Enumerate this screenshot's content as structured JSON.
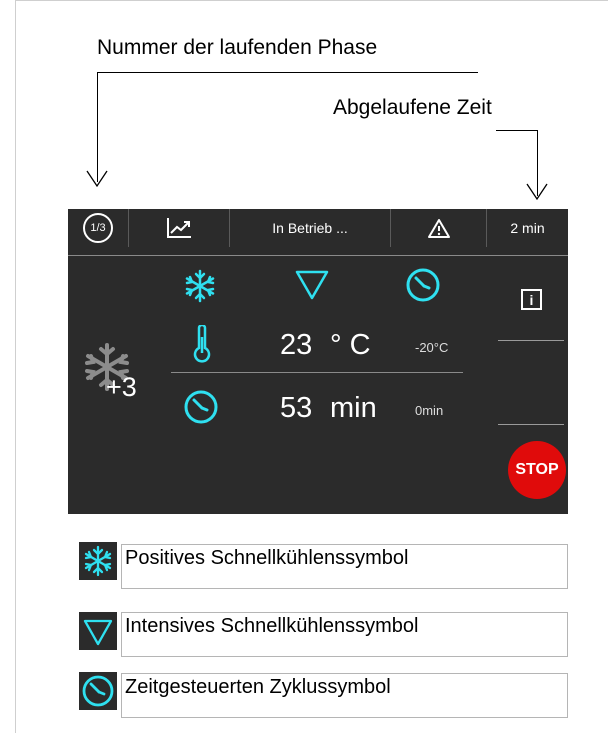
{
  "annotations": {
    "phase_number_label": "Nummer der laufenden Phase",
    "elapsed_time_label": "Abgelaufene Zeit"
  },
  "status_bar": {
    "phase": "1/3",
    "status_text": "In Betrieb ...",
    "elapsed_time": "2 min"
  },
  "main": {
    "counter": "+3",
    "temperature_value": "23",
    "temperature_unit": "° C",
    "temperature_setpoint": "-20°C",
    "time_value": "53",
    "time_unit": "min",
    "time_setpoint": "0min",
    "stop_label": "STOP"
  },
  "legend": [
    {
      "icon": "snowflake-icon",
      "text": "Positives Schnellkühlenssymbol"
    },
    {
      "icon": "triangle-down-icon",
      "text": "Intensives Schnellkühlenssymbol"
    },
    {
      "icon": "clock-icon",
      "text": "Zeitgesteuerten Zyklussymbol"
    }
  ],
  "colors": {
    "screen_bg": "#2b2b2b",
    "accent_cyan": "#2fe0f0",
    "stop_red": "#e00b0b"
  }
}
